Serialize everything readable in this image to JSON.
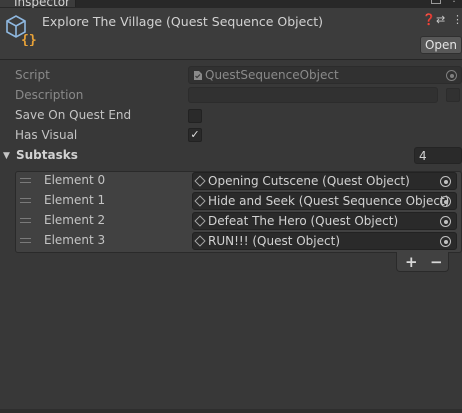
{
  "window": {
    "tab_label": "Inspector"
  },
  "header": {
    "title": "Explore The Village (Quest Sequence Object)",
    "open_button": "Open",
    "icons": [
      "prefab-cube-icon",
      "help-icon",
      "preset-sliders-icon",
      "more-menu-icon"
    ]
  },
  "fields": {
    "script": {
      "label": "Script",
      "value": "QuestSequenceObject"
    },
    "description": {
      "label": "Description",
      "value": ""
    },
    "save_on_quest_end": {
      "label": "Save On Quest End",
      "checked": false
    },
    "has_visual": {
      "label": "Has Visual",
      "checked": true,
      "check_glyph": "✓"
    }
  },
  "subtasks": {
    "label": "Subtasks",
    "size": "4",
    "elements": [
      {
        "label": "Element 0",
        "value": "Opening Cutscene (Quest Object)"
      },
      {
        "label": "Element 1",
        "value": "Hide and Seek (Quest Sequence Object)"
      },
      {
        "label": "Element 2",
        "value": "Defeat The Hero (Quest Object)"
      },
      {
        "label": "Element 3",
        "value": "RUN!!! (Quest Object)"
      }
    ],
    "add_label": "+",
    "remove_label": "−"
  },
  "colors": {
    "accent": "#3a79bb",
    "icon_orange": "#e8a238",
    "icon_blue": "#8fb8e0"
  }
}
